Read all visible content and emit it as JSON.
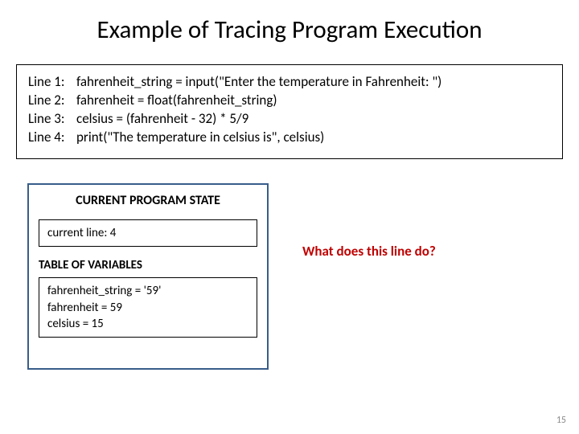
{
  "title": "Example of Tracing Program Execution",
  "code": {
    "lines": [
      {
        "n": "Line 1:",
        "text": "fahrenheit_string = input(\"Enter the temperature in Fahrenheit: \")"
      },
      {
        "n": "Line 2:",
        "text": "fahrenheit = float(fahrenheit_string)"
      },
      {
        "n": "Line 3:",
        "text": "celsius = (fahrenheit - 32) * 5/9"
      },
      {
        "n": "Line 4:",
        "text": "print(\"The temperature in celsius is\", celsius)"
      }
    ]
  },
  "state": {
    "header": "CURRENT PROGRAM STATE",
    "current_line_label": "current line: 4",
    "table_label": "TABLE OF VARIABLES",
    "vars": [
      "fahrenheit_string = '59'",
      "fahrenheit = 59",
      "celsius = 15"
    ]
  },
  "question": "What does this line do?",
  "page_number": "15"
}
